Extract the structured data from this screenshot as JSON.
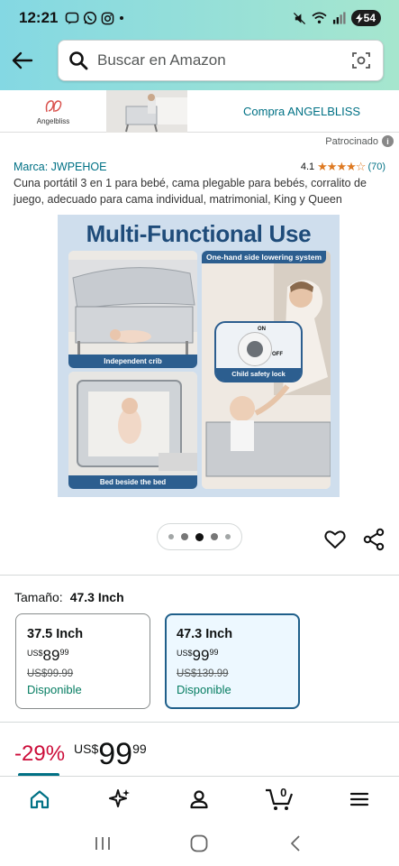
{
  "status_bar": {
    "time": "12:21",
    "battery": "54"
  },
  "search": {
    "placeholder": "Buscar en Amazon"
  },
  "ad_banner": {
    "brand": "Angelbliss",
    "cta": "Compra ANGELBLISS"
  },
  "sponsored": {
    "label": "Patrocinado"
  },
  "product": {
    "brand": "Marca: JWPEHOE",
    "rating_value": "4.1",
    "rating_count": "(70)",
    "title": "Cuna portátil 3 en 1 para bebé, cama plegable para bebés, corralito de juego, adecuado para cama individual, matrimonial, King y Queen",
    "image": {
      "heading": "Multi-Functional Use",
      "caption_crib": "Independent crib",
      "caption_bed": "Bed beside the bed",
      "tag_lowering": "One-hand side lowering system",
      "tag_lock": "Child safety lock",
      "knob_on": "ON",
      "knob_off": "OFF"
    },
    "gallery": {
      "count": 5,
      "active_index": 2
    }
  },
  "size": {
    "label": "Tamaño:",
    "value": "47.3 Inch",
    "options": [
      {
        "name": "37.5 Inch",
        "currency": "US$",
        "whole": "89",
        "fraction": "99",
        "list_price": "US$99.99",
        "availability": "Disponible",
        "selected": false
      },
      {
        "name": "47.3 Inch",
        "currency": "US$",
        "whole": "99",
        "fraction": "99",
        "list_price": "US$139.99",
        "availability": "Disponible",
        "selected": true
      }
    ]
  },
  "price": {
    "discount": "-29%",
    "currency": "US$",
    "whole": "99",
    "fraction": "99"
  },
  "bottom_nav": {
    "cart_count": "0"
  },
  "colors": {
    "accent_teal": "#007185",
    "deal_red": "#cc0c39",
    "available_green": "#067d62",
    "star_orange": "#de7921"
  }
}
